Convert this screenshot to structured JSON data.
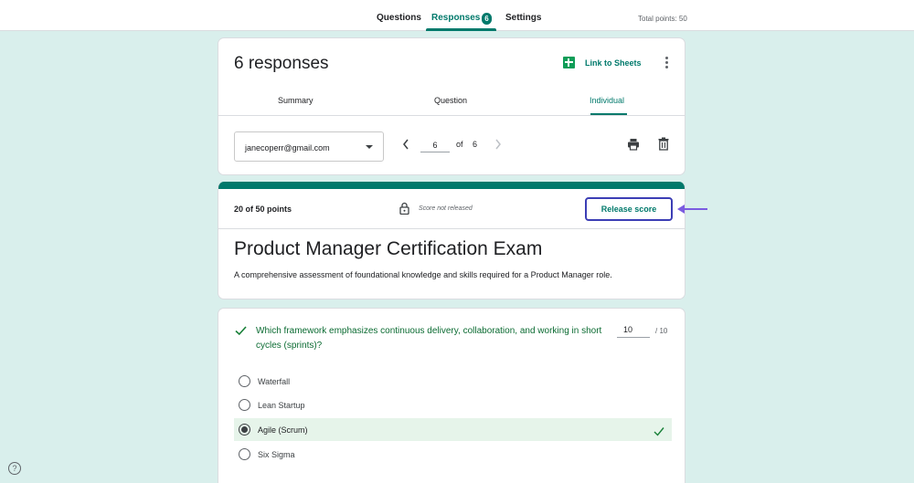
{
  "nav": {
    "tabs": [
      {
        "label": "Questions"
      },
      {
        "label": "Responses",
        "badge": "6"
      },
      {
        "label": "Settings"
      }
    ],
    "total_points": "Total points: 50"
  },
  "summary": {
    "title": "6 responses",
    "link_sheets": "Link to Sheets",
    "subtabs": [
      "Summary",
      "Question",
      "Individual"
    ],
    "email": "janecoperr@gmail.com",
    "page_current": "6",
    "page_of": "of",
    "page_total": "6"
  },
  "score": {
    "points": "20 of 50 points",
    "status": "Score not released",
    "release_label": "Release score",
    "exam_title": "Product Manager Certification Exam",
    "exam_desc": "A comprehensive assessment of foundational knowledge and skills required for a Product Manager role."
  },
  "question": {
    "text": "Which framework emphasizes continuous delivery, collaboration, and working in short cycles (sprints)?",
    "score": "10",
    "max": "/ 10",
    "options": [
      {
        "label": "Waterfall",
        "selected": false,
        "correct": false
      },
      {
        "label": "Lean Startup",
        "selected": false,
        "correct": false
      },
      {
        "label": "Agile (Scrum)",
        "selected": true,
        "correct": true
      },
      {
        "label": "Six Sigma",
        "selected": false,
        "correct": false
      }
    ]
  },
  "colors": {
    "accent": "#00796b",
    "background": "#d9efec",
    "correct_bg": "#e6f4ea",
    "highlight_border": "#3c3eb5",
    "annotation_arrow": "#7b5ce0"
  }
}
